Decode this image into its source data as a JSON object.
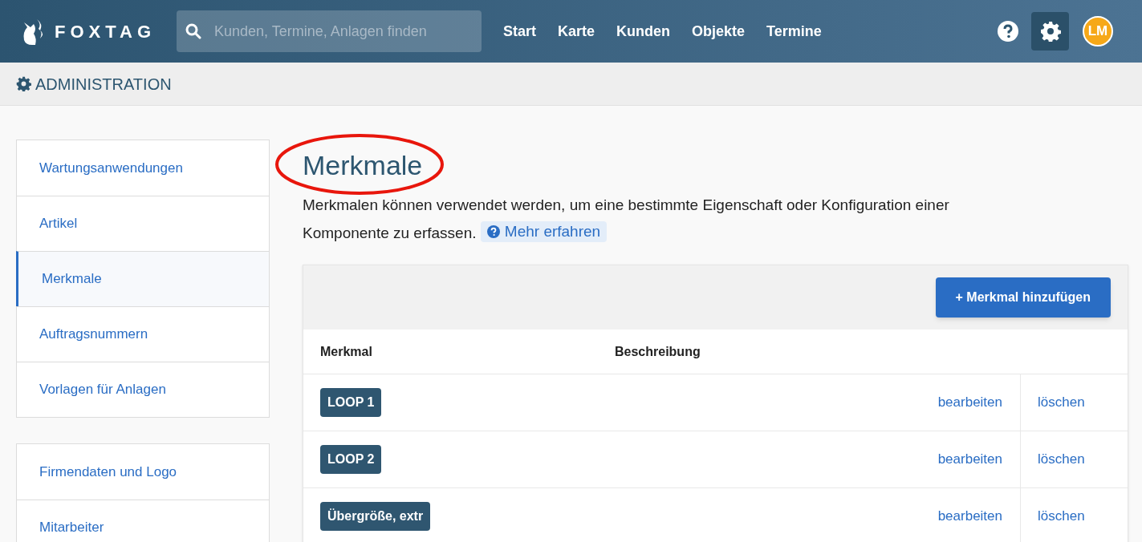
{
  "header": {
    "logo": "FOXTAG",
    "search": {
      "placeholder": "Kunden, Termine, Anlagen finden"
    },
    "nav": [
      {
        "label": "Start"
      },
      {
        "label": "Karte"
      },
      {
        "label": "Kunden"
      },
      {
        "label": "Objekte"
      },
      {
        "label": "Termine"
      }
    ],
    "settings_active": true,
    "avatar": "LM"
  },
  "section_title": "ADMINISTRATION",
  "sidebar": {
    "groups": [
      {
        "items": [
          {
            "label": "Wartungsanwendungen",
            "selected": false
          },
          {
            "label": "Artikel",
            "selected": false
          },
          {
            "label": "Merkmale",
            "selected": true
          },
          {
            "label": "Auftragsnummern",
            "selected": false
          },
          {
            "label": "Vorlagen für Anlagen",
            "selected": false
          }
        ]
      },
      {
        "items": [
          {
            "label": "Firmendaten und Logo",
            "selected": false
          },
          {
            "label": "Mitarbeiter",
            "selected": false
          }
        ]
      }
    ]
  },
  "page": {
    "title": "Merkmale",
    "title_circled": true,
    "description": "Merkmalen können verwendet werden, um eine bestimmte Eigenschaft oder Konfiguration einer Komponente zu erfassen.",
    "learn_more": "Mehr erfahren"
  },
  "table": {
    "add_button": "+ Merkmal hinzufügen",
    "columns": [
      "Merkmal",
      "Beschreibung"
    ],
    "rows": [
      {
        "tag": "LOOP 1",
        "description": "",
        "edit": "bearbeiten",
        "delete": "löschen"
      },
      {
        "tag": "LOOP 2",
        "description": "",
        "edit": "bearbeiten",
        "delete": "löschen"
      },
      {
        "tag": "Übergröße, extr",
        "description": "",
        "edit": "bearbeiten",
        "delete": "löschen"
      }
    ]
  }
}
